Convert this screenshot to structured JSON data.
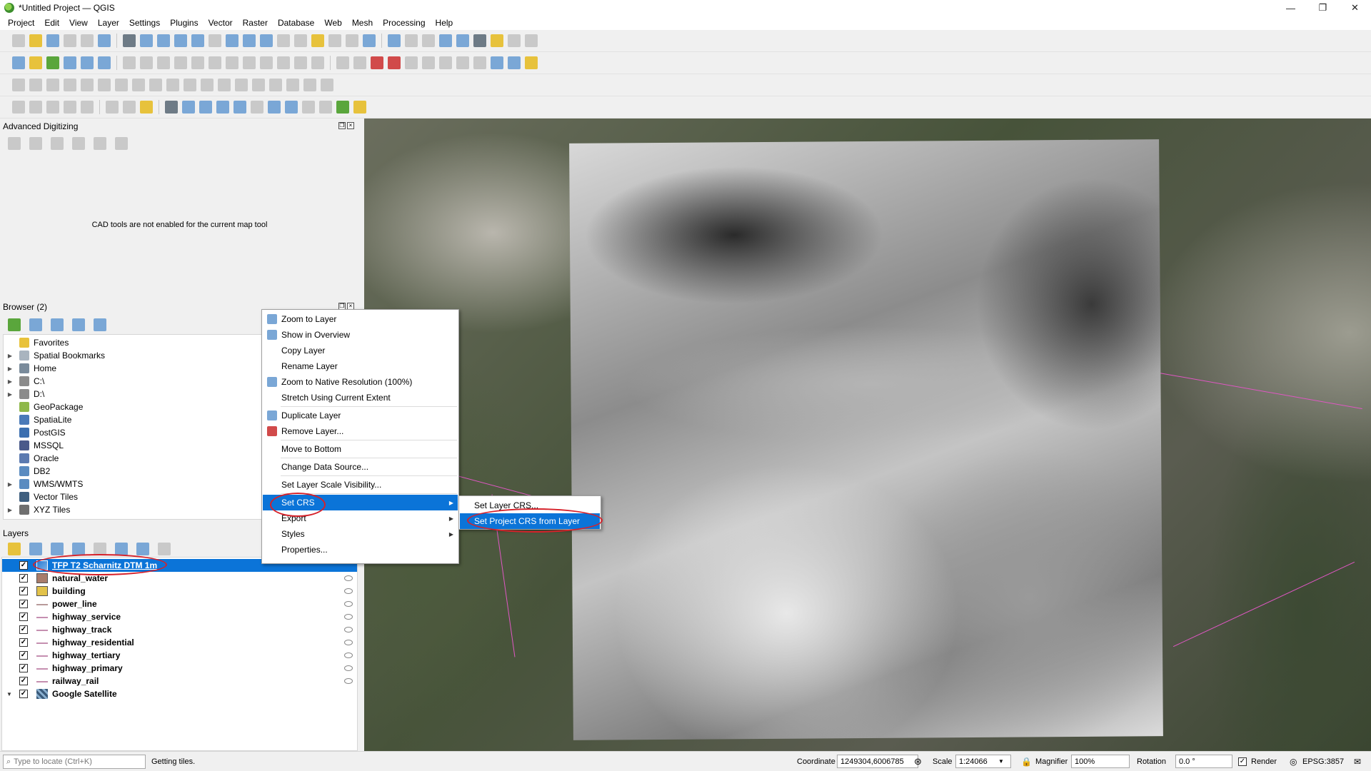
{
  "window": {
    "title": "*Untitled Project — QGIS",
    "minimize": "—",
    "maximize": "❐",
    "close": "✕"
  },
  "menubar": [
    "Project",
    "Edit",
    "View",
    "Layer",
    "Settings",
    "Plugins",
    "Vector",
    "Raster",
    "Database",
    "Web",
    "Mesh",
    "Processing",
    "Help"
  ],
  "panels": {
    "advanced_digitizing": {
      "title": "Advanced Digitizing",
      "message": "CAD tools are not enabled for the current map tool"
    },
    "browser": {
      "title": "Browser (2)",
      "items": [
        {
          "label": "Favorites",
          "icon": "star-icon",
          "expandable": false
        },
        {
          "label": "Spatial Bookmarks",
          "icon": "bookmark-icon",
          "expandable": true
        },
        {
          "label": "Home",
          "icon": "home-folder-icon",
          "expandable": true
        },
        {
          "label": "C:\\",
          "icon": "drive-icon",
          "expandable": true
        },
        {
          "label": "D:\\",
          "icon": "drive-icon",
          "expandable": true
        },
        {
          "label": "GeoPackage",
          "icon": "geopackage-icon",
          "expandable": false
        },
        {
          "label": "SpatiaLite",
          "icon": "spatialite-icon",
          "expandable": false
        },
        {
          "label": "PostGIS",
          "icon": "postgis-icon",
          "expandable": false
        },
        {
          "label": "MSSQL",
          "icon": "mssql-icon",
          "expandable": false
        },
        {
          "label": "Oracle",
          "icon": "oracle-icon",
          "expandable": false
        },
        {
          "label": "DB2",
          "icon": "db2-icon",
          "expandable": false
        },
        {
          "label": "WMS/WMTS",
          "icon": "wms-icon",
          "expandable": true
        },
        {
          "label": "Vector Tiles",
          "icon": "vector-tiles-icon",
          "expandable": false
        },
        {
          "label": "XYZ Tiles",
          "icon": "xyz-tiles-icon",
          "expandable": true
        }
      ]
    },
    "layers": {
      "title": "Layers",
      "items": [
        {
          "label": "TFP T2 Scharnitz DTM 1m",
          "checked": true,
          "symbol": "raster-icon",
          "selected": true
        },
        {
          "label": "natural_water",
          "checked": true,
          "symbol": "polygon-fill",
          "color": "#a97c6a"
        },
        {
          "label": "building",
          "checked": true,
          "symbol": "polygon-fill",
          "color": "#e2c24a"
        },
        {
          "label": "power_line",
          "checked": true,
          "symbol": "line-symbol",
          "color": "#b89a9a"
        },
        {
          "label": "highway_service",
          "checked": true,
          "symbol": "line-symbol",
          "color": "#c58fb0"
        },
        {
          "label": "highway_track",
          "checked": true,
          "symbol": "line-symbol",
          "color": "#c58fb0"
        },
        {
          "label": "highway_residential",
          "checked": true,
          "symbol": "line-symbol",
          "color": "#c58fb0"
        },
        {
          "label": "highway_tertiary",
          "checked": true,
          "symbol": "line-symbol",
          "color": "#c58fb0"
        },
        {
          "label": "highway_primary",
          "checked": true,
          "symbol": "line-symbol",
          "color": "#c58fb0"
        },
        {
          "label": "railway_rail",
          "checked": true,
          "symbol": "line-symbol",
          "color": "#c58fb0"
        },
        {
          "label": "Google Satellite",
          "checked": true,
          "symbol": "satellite-icon",
          "expanded": true
        }
      ]
    }
  },
  "context_menu": {
    "items": [
      {
        "label": "Zoom to Layer",
        "icon": "zoom-to-layer-icon"
      },
      {
        "label": "Show in Overview",
        "icon": "overview-icon"
      },
      {
        "label": "Copy Layer",
        "icon": ""
      },
      {
        "label": "Rename Layer",
        "icon": ""
      },
      {
        "label": "Zoom to Native Resolution (100%)",
        "icon": "zoom-native-icon"
      },
      {
        "label": "Stretch Using Current Extent",
        "icon": ""
      },
      {
        "label": "Duplicate Layer",
        "icon": "duplicate-icon"
      },
      {
        "label": "Remove Layer...",
        "icon": "remove-layer-icon"
      },
      {
        "label": "Move to Bottom",
        "icon": ""
      },
      {
        "label": "Change Data Source...",
        "icon": ""
      },
      {
        "label": "Set Layer Scale Visibility...",
        "icon": ""
      },
      {
        "label": "Set CRS",
        "icon": "",
        "submenu": true,
        "active": true
      },
      {
        "label": "Export",
        "icon": "",
        "submenu": true
      },
      {
        "label": "Styles",
        "icon": "",
        "submenu": true
      },
      {
        "label": "Properties...",
        "icon": ""
      }
    ],
    "submenu": [
      {
        "label": "Set Layer CRS...",
        "active": false
      },
      {
        "label": "Set Project CRS from Layer",
        "active": true
      }
    ]
  },
  "statusbar": {
    "locator_placeholder": "Type to locate (Ctrl+K)",
    "message": "Getting tiles.",
    "coordinate_label": "Coordinate",
    "coordinate_value": "1249304,6006785",
    "scale_label": "Scale",
    "scale_value": "1:24066",
    "magnifier_label": "Magnifier",
    "magnifier_value": "100%",
    "rotation_label": "Rotation",
    "rotation_value": "0.0 °",
    "render_label": "Render",
    "render_checked": true,
    "crs_label": "EPSG:3857"
  },
  "colors": {
    "selection": "#0b74d8",
    "annotation": "#d6212a",
    "road_lines": "#e057c4"
  }
}
